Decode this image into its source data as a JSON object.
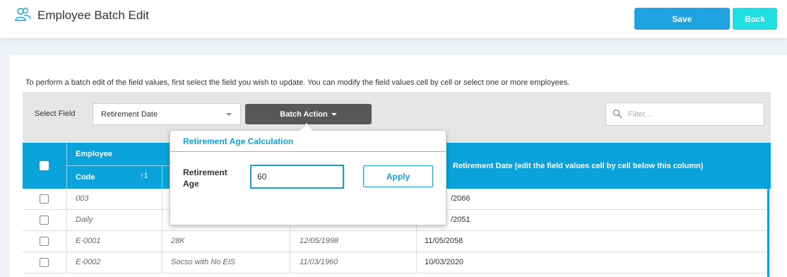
{
  "header": {
    "title": "Employee Batch Edit",
    "title_icon": "people-icon",
    "save_label": "Save",
    "back_label": "Back",
    "save_color": "#1fa3e0",
    "back_color": "#1ee0e0"
  },
  "instructions": "To perform a batch edit of the field values, first select the field you wish to update. You can modify the field values cell by cell or select one or more employees.",
  "toolbar": {
    "select_label": "Select Field",
    "select_value": "Retirement Date",
    "batch_action_label": "Batch Action",
    "filter_placeholder": "Filter..."
  },
  "table": {
    "group_header": "Employee",
    "code_header": "Code",
    "sort_indicator": "↑1",
    "retirement_header": "Retirement Date (edit the field values cell by cell below this column)",
    "header_color": "#0aa2da",
    "rows": [
      {
        "code": "003",
        "name": "",
        "dob": "",
        "retirement": "/2066"
      },
      {
        "code": "Daily",
        "name": "",
        "dob": "",
        "retirement": "/2051"
      },
      {
        "code": "E-0001",
        "name": "28K",
        "dob": "12/05/1998",
        "retirement": "11/05/2058"
      },
      {
        "code": "E-0002",
        "name": "Socso with No EIS",
        "dob": "11/03/1960",
        "retirement": "10/03/2020"
      }
    ]
  },
  "popover": {
    "title": "Retirement Age Calculation",
    "label": "Retirement Age",
    "input_value": "60",
    "apply_label": "Apply"
  }
}
